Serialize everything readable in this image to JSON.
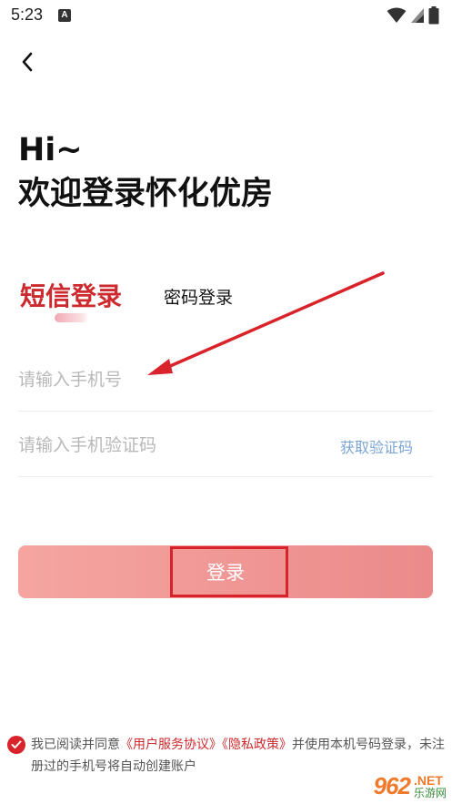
{
  "status_bar": {
    "time": "5:23",
    "notification_icon": "A"
  },
  "header": {
    "greeting": "Hi~",
    "welcome": "欢迎登录怀化优房"
  },
  "tabs": {
    "sms_label": "短信登录",
    "password_label": "密码登录",
    "active": "sms"
  },
  "form": {
    "phone_placeholder": "请输入手机号",
    "phone_value": "",
    "code_placeholder": "请输入手机验证码",
    "code_value": "",
    "get_code_label": "获取验证码"
  },
  "login_button": {
    "label": "登录"
  },
  "agreement": {
    "prefix": "我已阅读并同意",
    "user_agreement": "《用户服务协议》",
    "privacy_policy": "《隐私政策》",
    "suffix": "并使用本机号码登录，未注册过的手机号将自动创建账户",
    "checked": true
  },
  "watermark": {
    "logo": "962",
    "net": ".NET",
    "site_name": "乐游网"
  },
  "colors": {
    "accent": "#cc2a2e",
    "link_blue": "#7aa5d4",
    "button_gradient_start": "#f5a5a0",
    "button_gradient_end": "#eb8a8a"
  }
}
